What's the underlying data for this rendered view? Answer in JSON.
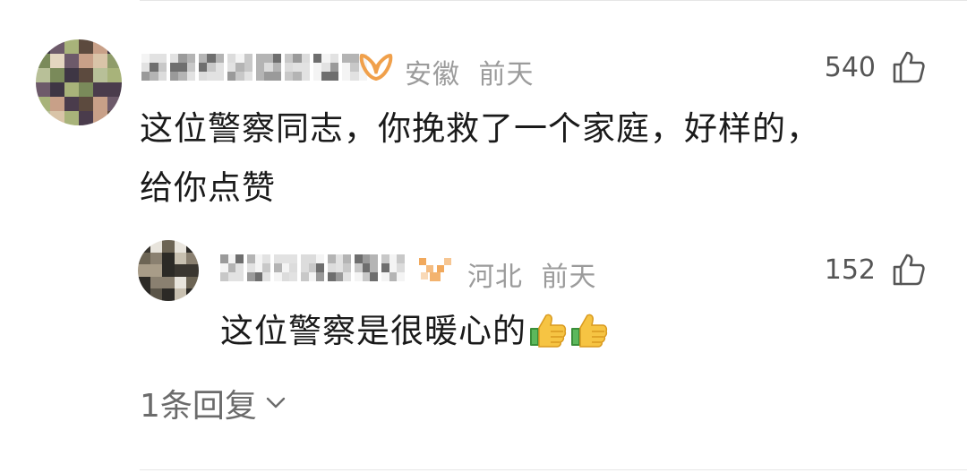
{
  "comment": {
    "location": "安徽",
    "time": "前天",
    "likes": "540",
    "text_line1": "这位警察同志，你挽救了一个家庭，好样的，",
    "text_line2": "给你点赞",
    "vip_color": "#f0a04b"
  },
  "reply": {
    "location": "河北",
    "time": "前天",
    "likes": "152",
    "text": "这位警察是很暖心的",
    "emoji": [
      "thumbs-up-icon",
      "thumbs-up-icon"
    ],
    "vip_color": "#f0a04b"
  },
  "replies_link": {
    "label": "1条回复"
  }
}
